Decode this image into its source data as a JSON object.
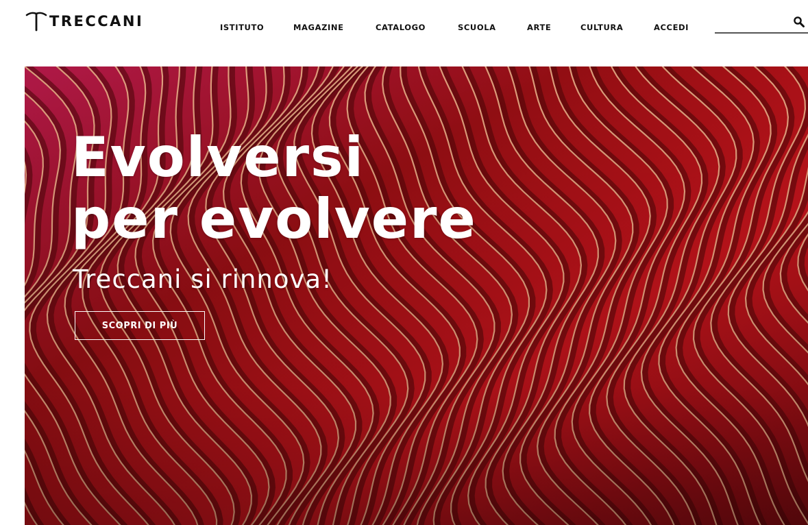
{
  "brand": {
    "name": "TRECCANI"
  },
  "nav": {
    "items": [
      {
        "label": "ISTITUTO"
      },
      {
        "label": "MAGAZINE"
      },
      {
        "label": "CATALOGO"
      },
      {
        "label": "SCUOLA"
      },
      {
        "label": "ARTE"
      },
      {
        "label": "CULTURA"
      },
      {
        "label": "ACCEDI"
      }
    ]
  },
  "search": {
    "value": "",
    "placeholder": "",
    "icon": "search-icon"
  },
  "hero": {
    "title_line1": "Evolversi",
    "title_line2": "per evolvere",
    "subtitle": "Treccani si rinnova!",
    "cta_label": "SCOPRI DI PIÙ",
    "image": "red wavy paper layers artwork"
  },
  "colors": {
    "background": "#ffffff",
    "text": "#111111",
    "hero_red": "#c8141c",
    "hero_dark": "#4a0508",
    "hero_highlight": "#f2b48c"
  }
}
